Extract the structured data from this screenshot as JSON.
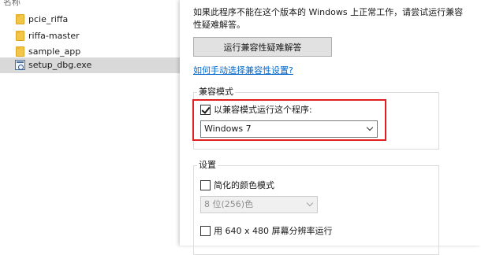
{
  "explorer": {
    "column_header": "名称",
    "files": [
      {
        "name": "pcie_riffa",
        "icon": "folder-icon",
        "selected": false
      },
      {
        "name": "riffa-master",
        "icon": "folder-icon",
        "selected": false
      },
      {
        "name": "sample_app",
        "icon": "folder-icon",
        "selected": false
      },
      {
        "name": "setup_dbg.exe",
        "icon": "exe-icon",
        "selected": true
      }
    ]
  },
  "compat_tab": {
    "intro": "如果此程序不能在这个版本的 Windows 上正常工作，请尝试运行兼容性疑难解答。",
    "run_troubleshooter_label": "运行兼容性疑难解答",
    "manual_link": "如何手动选择兼容性设置?",
    "compat_mode": {
      "group_label": "兼容模式",
      "checkbox_label": "以兼容模式运行这个程序:",
      "checked": true,
      "selected_os": "Windows 7"
    },
    "settings": {
      "group_label": "设置",
      "reduced_color_label": "简化的颜色模式",
      "reduced_color_checked": false,
      "color_depth_value": "8 位(256)色",
      "color_depth_disabled": true,
      "low_res_label": "用 640 x 480 屏幕分辨率运行",
      "low_res_checked": false
    }
  },
  "highlight_color": "#e02020"
}
